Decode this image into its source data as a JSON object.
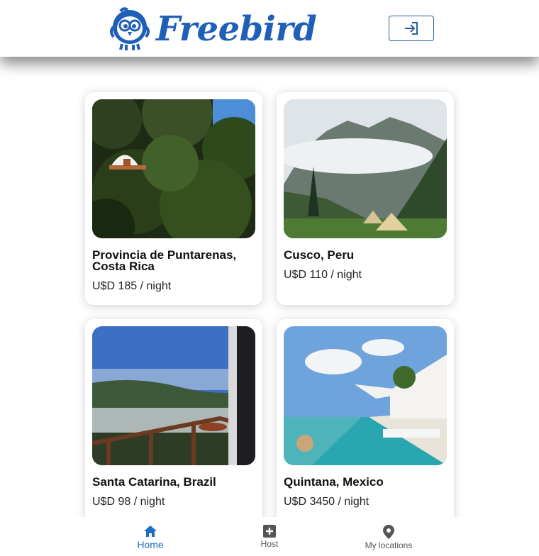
{
  "app": {
    "brand": "Freebird"
  },
  "header": {
    "login_icon": "login-icon"
  },
  "listings": [
    {
      "title": "Provincia de Puntarenas, Costa Rica",
      "price": "U$D 185 / night"
    },
    {
      "title": "Cusco, Peru",
      "price": "U$D 110 / night"
    },
    {
      "title": "Santa Catarina, Brazil",
      "price": "U$D 98 / night"
    },
    {
      "title": "Quintana, Mexico",
      "price": "U$D 3450 / night"
    }
  ],
  "nav": {
    "items": [
      {
        "label": "Home",
        "icon": "home-icon",
        "active": true
      },
      {
        "label": "Host",
        "icon": "plus-square-icon",
        "active": false
      },
      {
        "label": "My locations",
        "icon": "map-pin-icon",
        "active": false
      }
    ]
  },
  "colors": {
    "brand": "#1f5fb8",
    "nav_active": "#1f6cc4",
    "login_border": "#2a5f9e"
  }
}
